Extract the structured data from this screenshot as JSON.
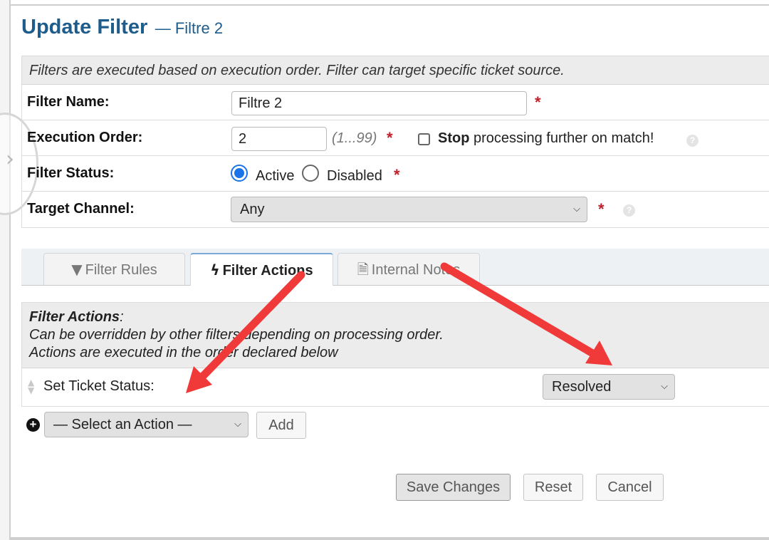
{
  "page": {
    "title": "Update Filter",
    "subtitle": "— Filtre 2"
  },
  "form": {
    "info": "Filters are executed based on execution order. Filter can target specific ticket source.",
    "filter_name": {
      "label": "Filter Name:",
      "value": "Filtre 2",
      "required": "*"
    },
    "execution_order": {
      "label": "Execution Order:",
      "value": "2",
      "hint": "(1...99)",
      "required": "*",
      "stop_bold": "Stop",
      "stop_rest": "processing further on match!",
      "stop_checked": false
    },
    "filter_status": {
      "label": "Filter Status:",
      "active": "Active",
      "disabled": "Disabled",
      "selected": "Active",
      "required": "*"
    },
    "target_channel": {
      "label": "Target Channel:",
      "value": "Any",
      "required": "*"
    },
    "help_glyph": "?"
  },
  "tabs": [
    {
      "label": "Filter Rules",
      "icon": "filter-icon",
      "glyph": "▼"
    },
    {
      "label": "Filter Actions",
      "icon": "bolt-icon",
      "glyph": "ϟ",
      "active": true
    },
    {
      "label": "Internal Notes",
      "icon": "document-icon",
      "glyph": "🗎"
    }
  ],
  "actions": {
    "heading": "Filter Actions",
    "heading_colon": ":",
    "line1": "Can be overridden by other filters depending on processing order.",
    "line2": "Actions are executed in the order declared below",
    "set_status_label": "Set Ticket Status:",
    "set_status_value": "Resolved",
    "add_select": "— Select an Action —",
    "add_button": "Add"
  },
  "buttons": {
    "save": "Save Changes",
    "reset": "Reset",
    "cancel": "Cancel"
  },
  "colors": {
    "title": "#1e5c8c",
    "required": "#c0202a",
    "arrow": "#f03a3a",
    "radio_active": "#1a73e8"
  },
  "icons": {
    "chevron": "⌵",
    "plus": "+",
    "side_chevron": "›"
  }
}
